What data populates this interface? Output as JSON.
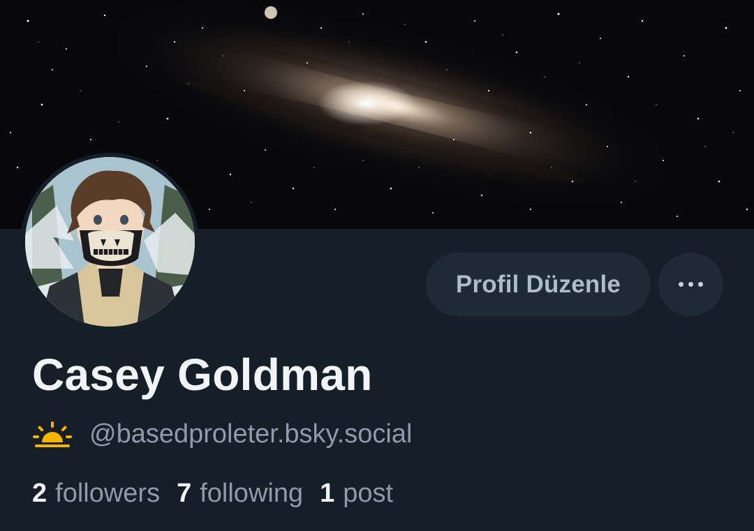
{
  "profile": {
    "display_name": "Casey Goldman",
    "handle": "@basedproleter.bsky.social",
    "handle_icon": "sun-icon",
    "avatar": "avatar-image",
    "banner": "galaxy-banner-image"
  },
  "actions": {
    "edit_profile_label": "Profil Düzenle",
    "more_icon": "ellipsis-icon"
  },
  "stats": {
    "followers_count": "2",
    "followers_label": "followers",
    "following_count": "7",
    "following_label": "following",
    "posts_count": "1",
    "posts_label": "post"
  },
  "colors": {
    "background": "#161e27",
    "button_bg": "#1e2a36",
    "text_primary": "#f2f5f8",
    "text_secondary": "#8e9bab",
    "sun_icon": "#f5b400"
  }
}
